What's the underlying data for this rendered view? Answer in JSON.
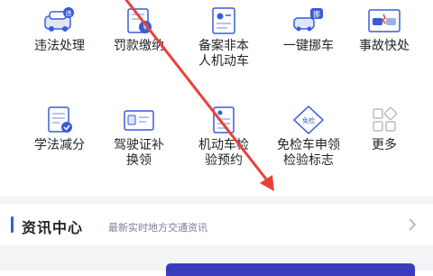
{
  "services": [
    {
      "label": "违法处理",
      "icon": "car-violation-icon"
    },
    {
      "label": "罚款缴纳",
      "icon": "fine-payment-icon"
    },
    {
      "label": "备案非本\n人机动车",
      "icon": "vehicle-registration-icon"
    },
    {
      "label": "一键挪车",
      "icon": "move-car-icon"
    },
    {
      "label": "事故快处",
      "icon": "accident-icon"
    },
    {
      "label": "学法减分",
      "icon": "study-law-icon"
    },
    {
      "label": "驾驶证补\n换领",
      "icon": "license-renew-icon"
    },
    {
      "label": "机动车检\n验预约",
      "icon": "vehicle-inspection-icon"
    },
    {
      "label": "免检车申领\n检验标志",
      "icon": "exempt-badge-icon"
    },
    {
      "label": "更多",
      "icon": "more-grid-icon"
    }
  ],
  "news": {
    "title": "资讯中心",
    "subtitle": "最新实时地方交通资讯"
  },
  "badges": {
    "move_car": "挪",
    "exempt": "免检"
  },
  "colors": {
    "accent": "#3a5bd9",
    "arrow": "#e8413a",
    "text": "#1f2329",
    "subtext": "#7b8190"
  }
}
